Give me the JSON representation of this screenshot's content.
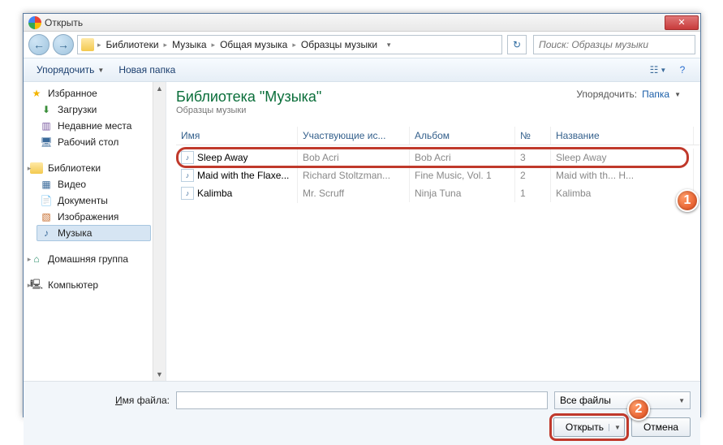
{
  "window": {
    "title": "Открыть"
  },
  "breadcrumb": [
    "Библиотеки",
    "Музыка",
    "Общая музыка",
    "Образцы музыки"
  ],
  "search": {
    "placeholder": "Поиск: Образцы музыки"
  },
  "toolbar": {
    "organize": "Упорядочить",
    "new_folder": "Новая папка"
  },
  "sidebar": {
    "favorites": {
      "head": "Избранное",
      "items": [
        "Загрузки",
        "Недавние места",
        "Рабочий стол"
      ]
    },
    "libraries": {
      "head": "Библиотеки",
      "items": [
        "Видео",
        "Документы",
        "Изображения",
        "Музыка"
      ]
    },
    "homegroup": "Домашняя группа",
    "computer": "Компьютер"
  },
  "library": {
    "title": "Библиотека \"Музыка\"",
    "subtitle": "Образцы музыки",
    "sort_label": "Упорядочить:",
    "sort_value": "Папка"
  },
  "columns": {
    "name": "Имя",
    "artist": "Участвующие ис...",
    "album": "Альбом",
    "no": "№",
    "title": "Название"
  },
  "rows": [
    {
      "name": "Sleep Away",
      "artist": "Bob Acri",
      "album": "Bob Acri",
      "no": "3",
      "title": "Sleep Away"
    },
    {
      "name": "Maid with the Flaxe...",
      "artist": "Richard Stoltzman...",
      "album": "Fine Music, Vol. 1",
      "no": "2",
      "title": "Maid with th... H..."
    },
    {
      "name": "Kalimba",
      "artist": "Mr. Scruff",
      "album": "Ninja Tuna",
      "no": "1",
      "title": "Kalimba"
    }
  ],
  "footer": {
    "filename_label": "Имя файла:",
    "filter": "Все файлы",
    "open": "Открыть",
    "cancel": "Отмена"
  },
  "annotations": {
    "b1": "1",
    "b2": "2"
  }
}
